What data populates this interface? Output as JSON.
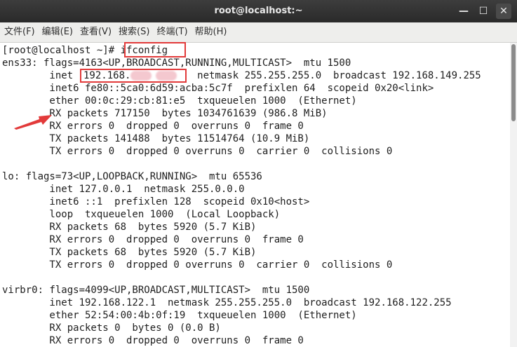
{
  "window": {
    "title": "root@localhost:~",
    "minimize_glyph": "—",
    "maximize_glyph": "☐",
    "close_glyph": "✕"
  },
  "menu": [
    "文件(F)",
    "编辑(E)",
    "查看(V)",
    "搜索(S)",
    "终端(T)",
    "帮助(H)"
  ],
  "terminal": {
    "prompt": "[root@localhost ~]# ",
    "command": "ifconfig",
    "ip_prefix": "192.168.",
    "lines": [
      "ens33: flags=4163<UP,BROADCAST,RUNNING,MULTICAST>  mtu 1500",
      "        inet                     netmask 255.255.255.0  broadcast 192.168.149.255",
      "        inet6 fe80::5ca0:6d59:acba:5c7f  prefixlen 64  scopeid 0x20<link>",
      "        ether 00:0c:29:cb:81:e5  txqueuelen 1000  (Ethernet)",
      "        RX packets 717150  bytes 1034761639 (986.8 MiB)",
      "        RX errors 0  dropped 0  overruns 0  frame 0",
      "        TX packets 141488  bytes 11514764 (10.9 MiB)",
      "        TX errors 0  dropped 0 overruns 0  carrier 0  collisions 0",
      "",
      "lo: flags=73<UP,LOOPBACK,RUNNING>  mtu 65536",
      "        inet 127.0.0.1  netmask 255.0.0.0",
      "        inet6 ::1  prefixlen 128  scopeid 0x10<host>",
      "        loop  txqueuelen 1000  (Local Loopback)",
      "        RX packets 68  bytes 5920 (5.7 KiB)",
      "        RX errors 0  dropped 0  overruns 0  frame 0",
      "        TX packets 68  bytes 5920 (5.7 KiB)",
      "        TX errors 0  dropped 0 overruns 0  carrier 0  collisions 0",
      "",
      "virbr0: flags=4099<UP,BROADCAST,MULTICAST>  mtu 1500",
      "        inet 192.168.122.1  netmask 255.255.255.0  broadcast 192.168.122.255",
      "        ether 52:54:00:4b:0f:19  txqueuelen 1000  (Ethernet)",
      "        RX packets 0  bytes 0 (0.0 B)",
      "        RX errors 0  dropped 0  overruns 0  frame 0"
    ]
  },
  "colors": {
    "annotation": "#e23a3a",
    "redaction": "#f4c8cf",
    "titlebar": "#2f2f2f",
    "menubar": "#eeeeec"
  },
  "icons": [
    "minimize-icon",
    "maximize-icon",
    "close-icon",
    "red-arrow-annotation-icon"
  ]
}
